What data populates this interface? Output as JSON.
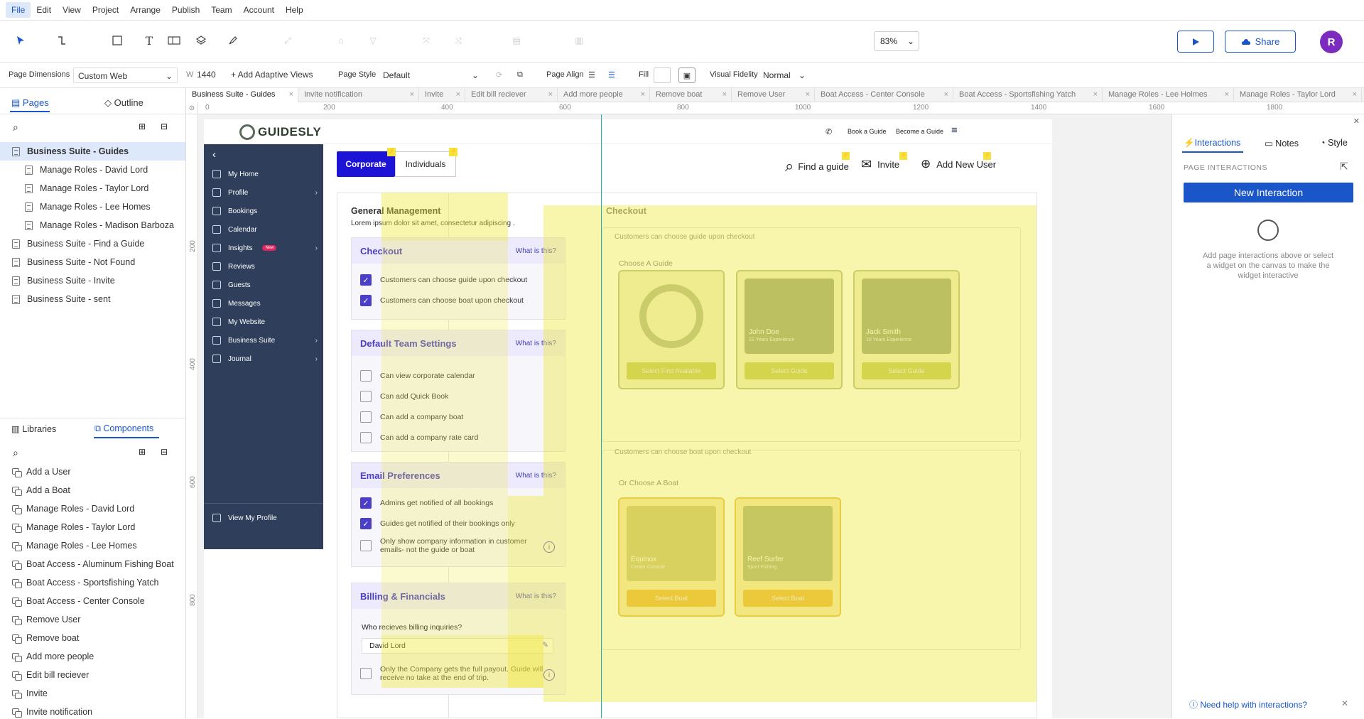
{
  "menubar": {
    "items": [
      "File",
      "Edit",
      "View",
      "Project",
      "Arrange",
      "Publish",
      "Team",
      "Account",
      "Help"
    ]
  },
  "toolbar": {
    "zoom": "83%",
    "share_label": "Share",
    "avatar_initial": "R"
  },
  "propbar": {
    "page_dimensions_label": "Page Dimensions",
    "page_dimensions_value": "Custom Web",
    "width_label": "W",
    "width_value": "1440",
    "adaptive_label": "+ Add Adaptive Views",
    "page_style_label": "Page Style",
    "page_style_value": "Default",
    "page_align_label": "Page Align",
    "fill_label": "Fill",
    "fidelity_label": "Visual Fidelity",
    "fidelity_value": "Normal"
  },
  "leftpanel": {
    "tabs": [
      "Pages",
      "Outline"
    ],
    "pages": [
      {
        "label": "Business Suite - Guides",
        "level": 0,
        "selected": true
      },
      {
        "label": "Manage Roles - David Lord",
        "level": 1
      },
      {
        "label": "Manage Roles - Taylor Lord",
        "level": 1
      },
      {
        "label": "Manage Roles - Lee Homes",
        "level": 1
      },
      {
        "label": "Manage Roles - Madison Barboza",
        "level": 1
      },
      {
        "label": "Business Suite - Find a Guide",
        "level": 0
      },
      {
        "label": "Business Suite - Not Found",
        "level": 0
      },
      {
        "label": "Business Suite - Invite",
        "level": 0
      },
      {
        "label": "Business Suite - sent",
        "level": 0
      }
    ],
    "lib_tabs": [
      "Libraries",
      "Components"
    ],
    "components": [
      "Add a User",
      "Add a Boat",
      "Manage Roles - David Lord",
      "Manage Roles - Taylor Lord",
      "Manage Roles - Lee Homes",
      "Boat Access - Aluminum Fishing Boat",
      "Boat Access - Sportsfishing Yatch",
      "Boat Access - Center Console",
      "Remove User",
      "Remove boat",
      "Add more people",
      "Edit bill reciever",
      "Invite",
      "Invite notification"
    ]
  },
  "doc_tabs": [
    "Business Suite - Guides",
    "Invite notification",
    "Invite",
    "Edit bill reciever",
    "Add more people",
    "Remove boat",
    "Remove User",
    "Boat Access - Center Console",
    "Boat Access - Sportsfishing Yatch",
    "Manage Roles - Lee Holmes",
    "Manage Roles - Taylor Lord"
  ],
  "ruler": {
    "h": [
      "0",
      "200",
      "400",
      "600",
      "800",
      "1000",
      "1200",
      "1400",
      "1600",
      "1800"
    ],
    "v": [
      "200",
      "400",
      "600",
      "800"
    ]
  },
  "app": {
    "brand": "GUIDESLY",
    "header_links": [
      "Book a Guide",
      "Become a Guide"
    ],
    "nav": [
      {
        "label": "My Home"
      },
      {
        "label": "Profile",
        "caret": true
      },
      {
        "label": "Bookings"
      },
      {
        "label": "Calendar"
      },
      {
        "label": "Insights",
        "badge": "New",
        "caret": true
      },
      {
        "label": "Reviews"
      },
      {
        "label": "Guests"
      },
      {
        "label": "Messages"
      },
      {
        "label": "My Website"
      },
      {
        "label": "Business Suite",
        "caret": true
      },
      {
        "label": "Journal",
        "caret": true
      }
    ],
    "view_profile": "View My Profile",
    "tab_corporate": "Corporate",
    "tab_individuals": "Individuals",
    "actions": [
      "Find a guide",
      "Invite",
      "Add New User"
    ],
    "section_title": "General Management",
    "section_desc": "Lorem ipsum dolor sit amet, consectetur adipiscing .",
    "what": "What is this?",
    "checkout": {
      "title": "Checkout",
      "items": [
        {
          "label": "Customers can choose guide upon checkout",
          "checked": true
        },
        {
          "label": "Customers can choose boat upon checkout",
          "checked": true
        }
      ]
    },
    "team": {
      "title": "Default Team Settings",
      "items": [
        {
          "label": "Can view corporate calendar",
          "checked": false
        },
        {
          "label": "Can add Quick Book",
          "checked": false
        },
        {
          "label": "Can add a company boat",
          "checked": false
        },
        {
          "label": "Can add a company rate card",
          "checked": false
        }
      ]
    },
    "email": {
      "title": "Email Preferences",
      "items": [
        {
          "label": "Admins get notified of all bookings",
          "checked": true
        },
        {
          "label": "Guides get notified of their bookings only",
          "checked": true
        },
        {
          "label": "Only show company information in customer emails- not the guide or boat",
          "checked": false
        }
      ]
    },
    "billing": {
      "title": "Billing & Financials",
      "question": "Who recieves billing inquiries?",
      "input_value": "David Lord",
      "payout": "Only the Company gets the full payout. Guide will receive no take at the end of trip."
    },
    "preview": {
      "title": "Checkout",
      "guide_note": "Customers can choose guide upon checkout",
      "choose_guide": "Choose A Guide",
      "guides": [
        {
          "name": "",
          "btn": "Select First Available"
        },
        {
          "name": "John Doe",
          "sub": "22 Years Experience",
          "btn": "Select Guide"
        },
        {
          "name": "Jack Smith",
          "sub": "10 Years Experience",
          "btn": "Select Guide"
        }
      ],
      "boat_note": "Customers can choose boat upon checkout",
      "choose_boat": "Or Choose A Boat",
      "boats": [
        {
          "name": "Equinox",
          "sub": "Center Console",
          "btn": "Select Boat"
        },
        {
          "name": "Reef Surfer",
          "sub": "Sport Fishing",
          "btn": "Select Boat"
        }
      ]
    }
  },
  "rightpanel": {
    "tabs": [
      "Interactions",
      "Notes",
      "Style"
    ],
    "section": "PAGE INTERACTIONS",
    "new_interaction": "New Interaction",
    "hint": "Add page interactions above or select a widget on the canvas to make the widget interactive",
    "help": "Need help with interactions?"
  },
  "colors": {
    "accent": "#1a56c9",
    "brand_purple": "#4a3fc6",
    "sidebar": "#2f3e5a",
    "highlight": "#eee83c"
  }
}
